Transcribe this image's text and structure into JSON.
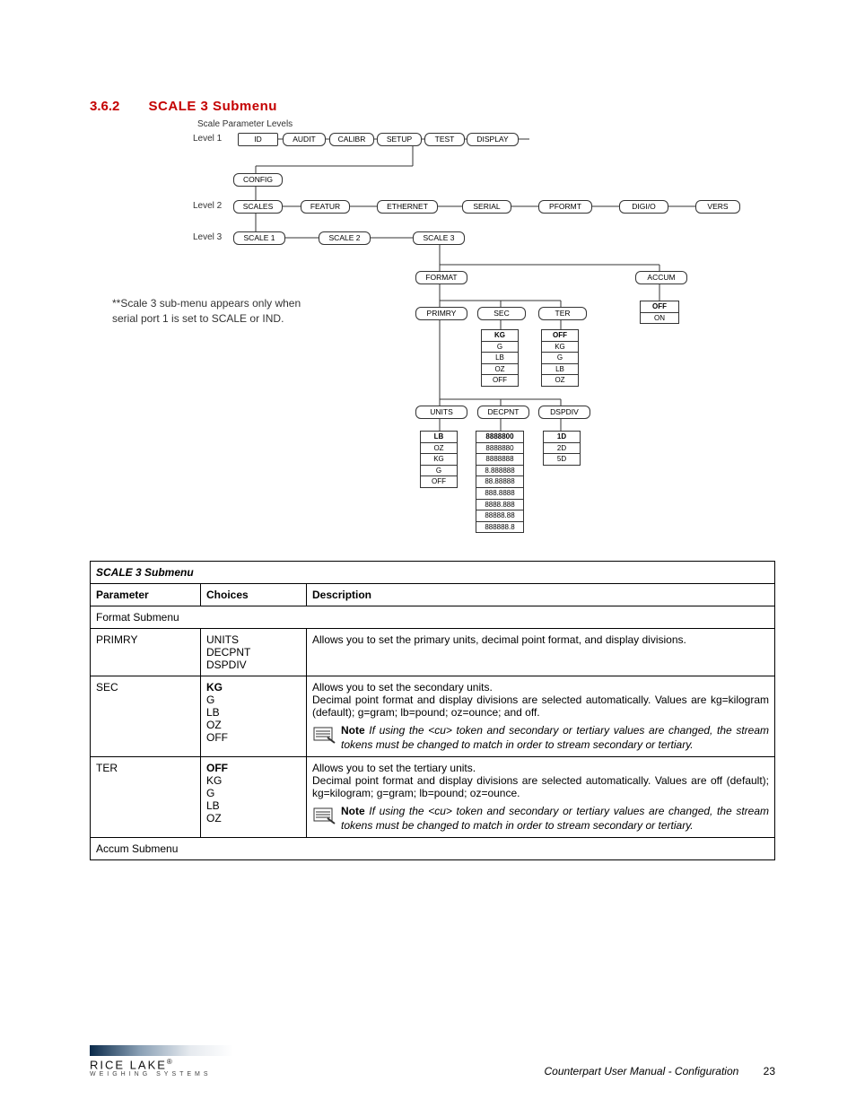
{
  "heading": {
    "number": "3.6.2",
    "title": "SCALE 3 Submenu"
  },
  "diagram": {
    "top_label": "Scale Parameter Levels",
    "levels": {
      "l1": "Level 1",
      "l2": "Level 2",
      "l3": "Level 3"
    },
    "row1": {
      "id": "ID",
      "audit": "AUDIT",
      "calibr": "CALIBR",
      "setup": "SETUP",
      "test": "TEST",
      "display": "DISPLAY"
    },
    "config": "CONFIG",
    "row2": {
      "scales": "SCALES",
      "featur": "FEATUR",
      "ethernet": "ETHERNET",
      "serial": "SERIAL",
      "pformt": "PFORMT",
      "digio": "DIGI/O",
      "vers": "VERS"
    },
    "row3": {
      "scale1": "SCALE 1",
      "scale2": "SCALE 2",
      "scale3": "SCALE 3"
    },
    "format": "FORMAT",
    "accum": "ACCUM",
    "row4": {
      "primry": "PRIMRY",
      "sec": "SEC",
      "ter": "TER"
    },
    "accum_opts": {
      "off": "OFF",
      "on": "ON"
    },
    "sec_opts": {
      "a": "KG",
      "b": "G",
      "c": "LB",
      "d": "OZ",
      "e": "OFF"
    },
    "ter_opts": {
      "a": "OFF",
      "b": "KG",
      "c": "G",
      "d": "LB",
      "e": "OZ"
    },
    "row5": {
      "units": "UNITS",
      "decpnt": "DECPNT",
      "dspdiv": "DSPDIV"
    },
    "units_opts": {
      "a": "LB",
      "b": "OZ",
      "c": "KG",
      "d": "G",
      "e": "OFF"
    },
    "decpnt_opts": {
      "a": "8888800",
      "b": "8888880",
      "c": "8888888",
      "d": "8.888888",
      "e": "88.88888",
      "f": "888.8888",
      "g": "8888.888",
      "h": "88888.88",
      "i": "888888.8"
    },
    "dspdiv_opts": {
      "a": "1D",
      "b": "2D",
      "c": "5D"
    },
    "side_note_l1": "**Scale 3 sub-menu appears only when",
    "side_note_l2": "serial port 1 is set to SCALE or IND."
  },
  "table": {
    "caption": "SCALE 3 Submenu",
    "headers": {
      "param": "Parameter",
      "choices": "Choices",
      "desc": "Description"
    },
    "section1": "Format Submenu",
    "rows": {
      "primry": {
        "param": "PRIMRY",
        "choices": "UNITS\nDECPNT\nDSPDIV",
        "desc": "Allows you to set the primary units, decimal point format, and display divisions."
      },
      "sec": {
        "param": "SEC",
        "choices_bold": "KG",
        "choices_rest": "G\nLB\nOZ\nOFF",
        "desc_l1": "Allows you to set the secondary units.",
        "desc_l2": "Decimal point format and display divisions are selected automatically. Values are kg=kilogram (default); g=gram; lb=pound; oz=ounce; and off.",
        "note_label": "Note",
        "note": "If using the <cu> token and secondary or tertiary values are changed, the stream tokens must be changed to match in order to stream secondary or tertiary."
      },
      "ter": {
        "param": "TER",
        "choices_bold": "OFF",
        "choices_rest": "KG\nG\nLB\nOZ",
        "desc_l1": "Allows you to set the tertiary units.",
        "desc_l2": "Decimal point format and display divisions are selected automatically. Values are off (default); kg=kilogram; g=gram; lb=pound; oz=ounce.",
        "note_label": "Note",
        "note": "If using the <cu> token and secondary or tertiary values are changed, the stream tokens must be changed to match in order to stream secondary or tertiary."
      }
    },
    "section2": "Accum Submenu"
  },
  "footer": {
    "brand": "RICE LAKE",
    "brand_sub": "WEIGHING SYSTEMS",
    "doc": "Counterpart User Manual - Configuration",
    "page": "23"
  },
  "chart_data": {
    "type": "tree",
    "title": "Scale Parameter Levels",
    "levels": [
      {
        "level": 1,
        "nodes": [
          "ID",
          "AUDIT",
          "CALIBR",
          "SETUP",
          "TEST",
          "DISPLAY"
        ]
      },
      {
        "under": "SETUP",
        "node": "CONFIG"
      },
      {
        "level": 2,
        "under": "CONFIG",
        "nodes": [
          "SCALES",
          "FEATUR",
          "ETHERNET",
          "SERIAL",
          "PFORMT",
          "DIGI/O",
          "VERS"
        ]
      },
      {
        "level": 3,
        "under": "SCALES",
        "nodes": [
          "SCALE 1",
          "SCALE 2",
          "SCALE 3"
        ]
      },
      {
        "under": "SCALE 3",
        "nodes": [
          "FORMAT",
          "ACCUM"
        ]
      },
      {
        "under": "FORMAT",
        "nodes": [
          "PRIMRY",
          "SEC",
          "TER"
        ]
      },
      {
        "under": "ACCUM",
        "options": [
          "OFF",
          "ON"
        ],
        "default": "OFF"
      },
      {
        "under": "SEC",
        "options": [
          "KG",
          "G",
          "LB",
          "OZ",
          "OFF"
        ],
        "default": "KG"
      },
      {
        "under": "TER",
        "options": [
          "OFF",
          "KG",
          "G",
          "LB",
          "OZ"
        ],
        "default": "OFF"
      },
      {
        "under": "PRIMRY",
        "nodes": [
          "UNITS",
          "DECPNT",
          "DSPDIV"
        ]
      },
      {
        "under": "UNITS",
        "options": [
          "LB",
          "OZ",
          "KG",
          "G",
          "OFF"
        ],
        "default": "LB"
      },
      {
        "under": "DECPNT",
        "options": [
          "8888800",
          "8888880",
          "8888888",
          "8.888888",
          "88.88888",
          "888.8888",
          "8888.888",
          "88888.88",
          "888888.8"
        ],
        "default": "8888800"
      },
      {
        "under": "DSPDIV",
        "options": [
          "1D",
          "2D",
          "5D"
        ],
        "default": "1D"
      }
    ],
    "annotation": "**Scale 3 sub-menu appears only when serial port 1 is set to SCALE or IND."
  }
}
